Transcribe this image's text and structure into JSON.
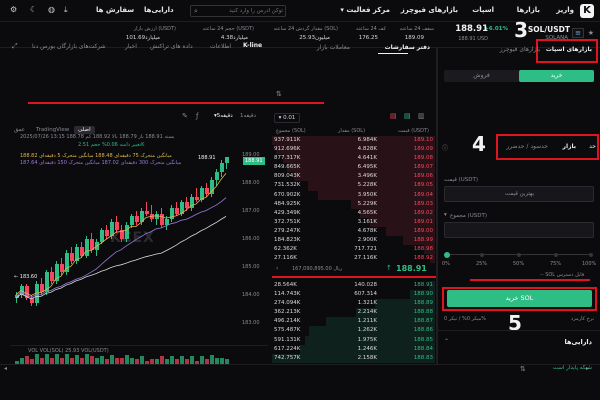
{
  "topbar": {
    "logo": "K",
    "nav": [
      "واریز",
      "بازارها",
      "اسپات",
      "بازارهای فیوچرز",
      "مرکز فعالیت",
      "دارایی‌ها",
      "سفارش ها"
    ],
    "activity_caret": "▾",
    "search_placeholder": "توکن آدرس را وارد کنید"
  },
  "ticker": {
    "pair": "SOL/USDT",
    "coin": "SOLANA",
    "price": "188.91",
    "price_usd": "188.91 USD",
    "change": "+6.01%",
    "stats": [
      {
        "label": "سقف 24 ساعته",
        "value": "189.09"
      },
      {
        "label": "کف 24 ساعته",
        "value": "176.25"
      },
      {
        "label": "مقدار گردش 24 ساعته (SOL)",
        "value": "25.93میلیون"
      },
      {
        "label": "حجم 24 ساعته (USDT)",
        "value": "4.38میلیارد"
      },
      {
        "label": "ارزش بازار (USDT)",
        "value": "101.69میلیارد"
      }
    ]
  },
  "annotations": {
    "n3": "3",
    "n4": "4",
    "n5": "5"
  },
  "trade": {
    "market_tabs": [
      "بازارهای فیوچرز",
      "بازارهای اسپات"
    ],
    "buy": "خرید",
    "sell": "فروش",
    "order_types": [
      "حد",
      "بازار",
      "حدسود / حدضرر"
    ],
    "price_label": "قیمت (USDT)",
    "price_placeholder": "بهترین قیمت",
    "total_label": "مجموع (USDT)",
    "slider_marks": [
      "0%",
      "25%",
      "50%",
      "75%",
      "100%"
    ],
    "available": "-- SOL قابل دسترس",
    "buy_button": "خرید SOL",
    "fee_label": "نرخ کارمزد",
    "fee_value": "میکر 0% / تیکر 0%",
    "assets_title": "دارایی‌ها",
    "bottom_status": "شبکه پایدار است"
  },
  "orderbook": {
    "tabs": [
      "دفتر سفارشات",
      "معاملات بازار"
    ],
    "precision": "0.01",
    "headers": [
      "قیمت (USDT)",
      "مقدار (SOL)",
      "مجموع (SOL)"
    ],
    "asks": [
      [
        "189.10",
        "6.984K",
        "937.911K"
      ],
      [
        "189.09",
        "4.828K",
        "912.696K"
      ],
      [
        "189.08",
        "4.641K",
        "877.317K"
      ],
      [
        "189.07",
        "6.495K",
        "849.665K"
      ],
      [
        "189.06",
        "3.496K",
        "809.043K"
      ],
      [
        "189.05",
        "5.228K",
        "731.532K"
      ],
      [
        "189.04",
        "3.950K",
        "670.902K"
      ],
      [
        "189.03",
        "5.229K",
        "484.925K"
      ],
      [
        "189.02",
        "4.565K",
        "429.349K"
      ],
      [
        "189.01",
        "3.161K",
        "372.751K"
      ],
      [
        "189.00",
        "4.678K",
        "279.247K"
      ],
      [
        "188.99",
        "2.900K",
        "184.823K"
      ],
      [
        "188.98",
        "717.721",
        "62.362K"
      ],
      [
        "188.92",
        "27.116K",
        "27.116K"
      ]
    ],
    "mid_price": "188.91",
    "mid_volume": "ریال 167,090,895.00",
    "bids": [
      [
        "188.91",
        "140.028",
        "28.564K"
      ],
      [
        "188.90",
        "607.314",
        "114.743K"
      ],
      [
        "188.89",
        "1.321K",
        "274.094K"
      ],
      [
        "188.88",
        "2.214K",
        "362.213K"
      ],
      [
        "188.87",
        "1.211K",
        "496.214K"
      ],
      [
        "188.86",
        "1.262K",
        "575.487K"
      ],
      [
        "188.85",
        "1.975K",
        "591.131K"
      ],
      [
        "188.84",
        "1.246K",
        "617.224K"
      ],
      [
        "188.83",
        "2.158K",
        "742.757K"
      ]
    ]
  },
  "chart": {
    "tabs": [
      "K-line",
      "اطلاعات",
      "داده های تراکنش",
      "اخبار",
      "شرکت‌های بازارگان بورس دنا"
    ],
    "interval": "5دقیقه",
    "time_label": "1دقیقه",
    "view_tabs": [
      "اصلی",
      "TradingView",
      "عمق"
    ],
    "ohlc": "2025/07/26 13:15  بسته 188.91  باز 188.79  بالا 188.92  کم 188.78",
    "change_line": "تغییر دامنه 0.06%  حجم 2.51K",
    "ma_lines": [
      "میانگین متحرک 75 دقیقه‌ای 188.48  میانگین متحرک 5 دقیقه‌ای 188.82",
      "میانگین متحرک 300 دقیقه‌ای 187.02  میانگین متحرک 150 دقیقه‌ای 187.64"
    ],
    "last_price": "188.91",
    "high_marker": "188.91",
    "low_marker": "183.60",
    "y_ticks": [
      "189.00",
      "188.00",
      "187.00",
      "186.00",
      "185.00",
      "184.00",
      "183.00"
    ],
    "vol_label": "VOL   VOL(SOL)  25.93  VOL(USDT)",
    "watermark": "KCEX",
    "ohlc_series": [
      [
        183.9,
        184.1,
        183.7,
        184.0
      ],
      [
        184.0,
        184.4,
        183.9,
        184.3
      ],
      [
        184.3,
        184.4,
        183.8,
        183.9
      ],
      [
        183.9,
        184.0,
        183.6,
        183.7
      ],
      [
        183.7,
        184.5,
        183.6,
        184.4
      ],
      [
        184.4,
        184.6,
        184.0,
        184.1
      ],
      [
        184.1,
        184.9,
        184.0,
        184.8
      ],
      [
        184.8,
        185.0,
        184.4,
        184.5
      ],
      [
        184.5,
        185.2,
        184.4,
        185.1
      ],
      [
        185.1,
        185.3,
        184.7,
        184.8
      ],
      [
        184.8,
        185.6,
        184.7,
        185.5
      ],
      [
        185.5,
        185.7,
        185.1,
        185.2
      ],
      [
        185.2,
        185.8,
        185.1,
        185.7
      ],
      [
        185.7,
        185.9,
        185.3,
        185.4
      ],
      [
        185.4,
        186.1,
        185.3,
        186.0
      ],
      [
        186.0,
        186.2,
        185.5,
        185.6
      ],
      [
        185.6,
        186.0,
        185.4,
        185.9
      ],
      [
        185.9,
        186.4,
        185.8,
        186.3
      ],
      [
        186.3,
        186.5,
        186.0,
        186.1
      ],
      [
        186.1,
        186.7,
        186.0,
        186.6
      ],
      [
        186.6,
        186.8,
        186.2,
        186.3
      ],
      [
        186.3,
        186.5,
        185.9,
        186.0
      ],
      [
        186.0,
        186.6,
        185.9,
        186.5
      ],
      [
        186.5,
        186.9,
        186.4,
        186.8
      ],
      [
        186.8,
        187.0,
        186.5,
        186.6
      ],
      [
        186.6,
        187.1,
        186.5,
        187.0
      ],
      [
        187.0,
        187.3,
        186.8,
        186.9
      ],
      [
        186.9,
        187.2,
        186.6,
        186.7
      ],
      [
        186.7,
        187.0,
        186.5,
        186.9
      ],
      [
        186.9,
        187.1,
        186.4,
        186.5
      ],
      [
        186.5,
        186.8,
        186.3,
        186.7
      ],
      [
        186.7,
        187.2,
        186.6,
        187.1
      ],
      [
        187.1,
        187.3,
        186.8,
        186.9
      ],
      [
        186.9,
        187.4,
        186.8,
        187.3
      ],
      [
        187.3,
        187.5,
        187.0,
        187.1
      ],
      [
        187.1,
        187.6,
        187.0,
        187.5
      ],
      [
        187.5,
        187.8,
        187.3,
        187.4
      ],
      [
        187.4,
        187.9,
        187.3,
        187.8
      ],
      [
        187.8,
        188.0,
        187.5,
        187.6
      ],
      [
        187.6,
        188.2,
        187.5,
        188.1
      ],
      [
        188.1,
        188.5,
        187.9,
        188.4
      ],
      [
        188.4,
        188.8,
        188.2,
        188.7
      ],
      [
        188.7,
        188.92,
        188.5,
        188.91
      ]
    ]
  }
}
